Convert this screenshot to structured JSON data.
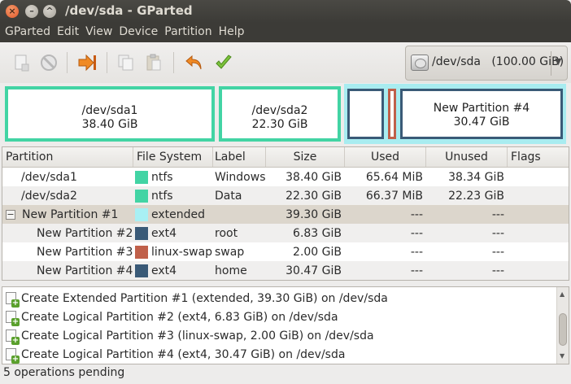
{
  "window": {
    "title": "/dev/sda - GParted"
  },
  "menu": [
    "GParted",
    "Edit",
    "View",
    "Device",
    "Partition",
    "Help"
  ],
  "toolbar": {
    "icons": [
      "new-partition",
      "delete",
      "resize-move",
      "copy",
      "paste",
      "undo",
      "apply"
    ]
  },
  "device": {
    "selected": "/dev/sda   (100.00 GiB)"
  },
  "diskmap": {
    "partitions": [
      {
        "name": "/dev/sda1",
        "size": "38.40 GiB",
        "color": "#42d4a4"
      },
      {
        "name": "/dev/sda2",
        "size": "22.30 GiB",
        "color": "#42d4a4"
      },
      {
        "name": "",
        "size": "",
        "color": "#3a5a77"
      },
      {
        "name": "",
        "size": "",
        "color": "#c0604a"
      },
      {
        "name": "New Partition #4",
        "size": "30.47 GiB",
        "color": "#3a5a77"
      }
    ],
    "extended_color": "#a8ecf0"
  },
  "table": {
    "headers": [
      "Partition",
      "File System",
      "Label",
      "Size",
      "Used",
      "Unused",
      "Flags"
    ],
    "rows": [
      {
        "partition": "/dev/sda1",
        "fs": "ntfs",
        "fs_color": "#42d4a4",
        "label": "Windows",
        "size": "38.40 GiB",
        "used": "65.64 MiB",
        "unused": "38.34 GiB",
        "flags": ""
      },
      {
        "partition": "/dev/sda2",
        "fs": "ntfs",
        "fs_color": "#42d4a4",
        "label": "Data",
        "size": "22.30 GiB",
        "used": "66.37 MiB",
        "unused": "22.23 GiB",
        "flags": ""
      },
      {
        "partition": "New Partition #1",
        "fs": "extended",
        "fs_color": "#a8f0f4",
        "label": "",
        "size": "39.30 GiB",
        "used": "---",
        "unused": "---",
        "flags": "",
        "expander": "−"
      },
      {
        "partition": "New Partition #2",
        "fs": "ext4",
        "fs_color": "#3a5a77",
        "label": "root",
        "size": "6.83 GiB",
        "used": "---",
        "unused": "---",
        "flags": ""
      },
      {
        "partition": "New Partition #3",
        "fs": "linux-swap",
        "fs_color": "#c0604a",
        "label": "swap",
        "size": "2.00 GiB",
        "used": "---",
        "unused": "---",
        "flags": ""
      },
      {
        "partition": "New Partition #4",
        "fs": "ext4",
        "fs_color": "#3a5a77",
        "label": "home",
        "size": "30.47 GiB",
        "used": "---",
        "unused": "---",
        "flags": ""
      }
    ]
  },
  "operations": [
    "Create Extended Partition #1 (extended, 39.30 GiB) on /dev/sda",
    "Create Logical Partition #2 (ext4, 6.83 GiB) on /dev/sda",
    "Create Logical Partition #3 (linux-swap, 2.00 GiB) on /dev/sda",
    "Create Logical Partition #4 (ext4, 30.47 GiB) on /dev/sda"
  ],
  "status": "5 operations pending"
}
